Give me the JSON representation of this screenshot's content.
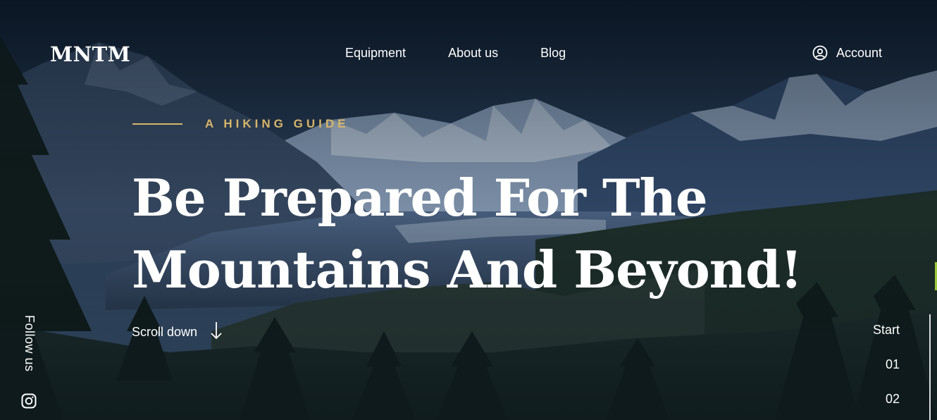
{
  "brand": {
    "logo": "MNTM"
  },
  "nav": {
    "items": [
      "Equipment",
      "About us",
      "Blog"
    ],
    "account_label": "Account"
  },
  "hero": {
    "eyebrow": "A HIKING GUIDE",
    "headline_line1": "Be Prepared For The",
    "headline_line2": "Mountains And Beyond!",
    "scroll_label": "Scroll down"
  },
  "social": {
    "follow_label": "Follow us",
    "icon": "instagram-icon"
  },
  "slider": {
    "items": [
      "Start",
      "01",
      "02"
    ]
  },
  "colors": {
    "accent_gold": "#d6b56a",
    "accent_green": "#9bc83a",
    "sky_dark": "#0f1c2c",
    "mountain_blue": "#2c4568"
  }
}
